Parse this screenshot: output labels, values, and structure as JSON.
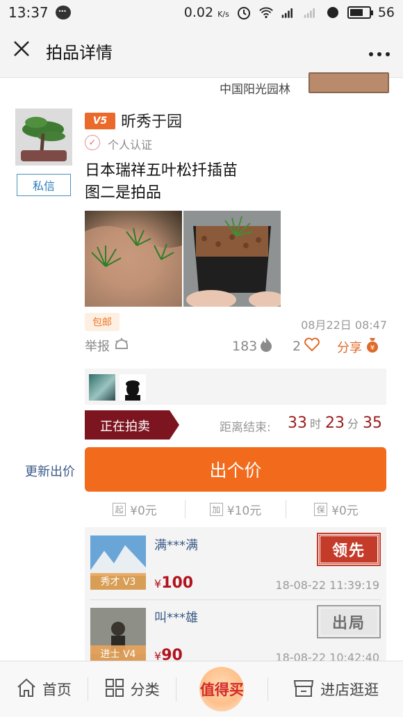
{
  "status_bar": {
    "time": "13:37",
    "speed_value": "0.02",
    "speed_unit": "K/s",
    "battery": "56"
  },
  "navbar": {
    "title": "拍品详情"
  },
  "previous_item": {
    "shop_name": "中国阳光园林"
  },
  "seller": {
    "level": "V5",
    "name": "昕秀于园",
    "certification": "个人认证",
    "message_button": "私信"
  },
  "item": {
    "description_line1": "日本瑞祥五叶松扦插苗",
    "description_line2": "图二是拍品",
    "tag": "包邮",
    "posted_at": "08月22日 08:47",
    "report_label": "举报",
    "views": "183",
    "likes": "2",
    "share_label": "分享"
  },
  "auction": {
    "status": "正在拍卖",
    "countdown_label": "距离结束:",
    "hours": "33",
    "hours_unit": "时",
    "minutes": "23",
    "minutes_unit": "分",
    "seconds": "35",
    "update_bid": "更新出价",
    "bid_button": "出个价",
    "rules": [
      {
        "icon_text": "起",
        "value": "¥0元"
      },
      {
        "icon_text": "加",
        "value": "¥10元"
      },
      {
        "icon_text": "保",
        "value": "¥0元"
      }
    ]
  },
  "bids": [
    {
      "user": "满***满",
      "level": "秀才 V3",
      "currency": "¥",
      "amount": "100",
      "time": "18-08-22 11:39:19",
      "stamp": "领先"
    },
    {
      "user": "叫***雄",
      "level": "进士 V4",
      "currency": "¥",
      "amount": "90",
      "time": "18-08-22 10:42:40",
      "stamp": "出局"
    }
  ],
  "tabbar": {
    "home": "首页",
    "category": "分类",
    "best": "值得买",
    "shop": "进店逛逛"
  },
  "colors": {
    "accent": "#f26b1d",
    "countdown": "#9b1c1c",
    "price": "#b2121d",
    "link": "#3a5a86",
    "ribbon": "#7c1520"
  }
}
